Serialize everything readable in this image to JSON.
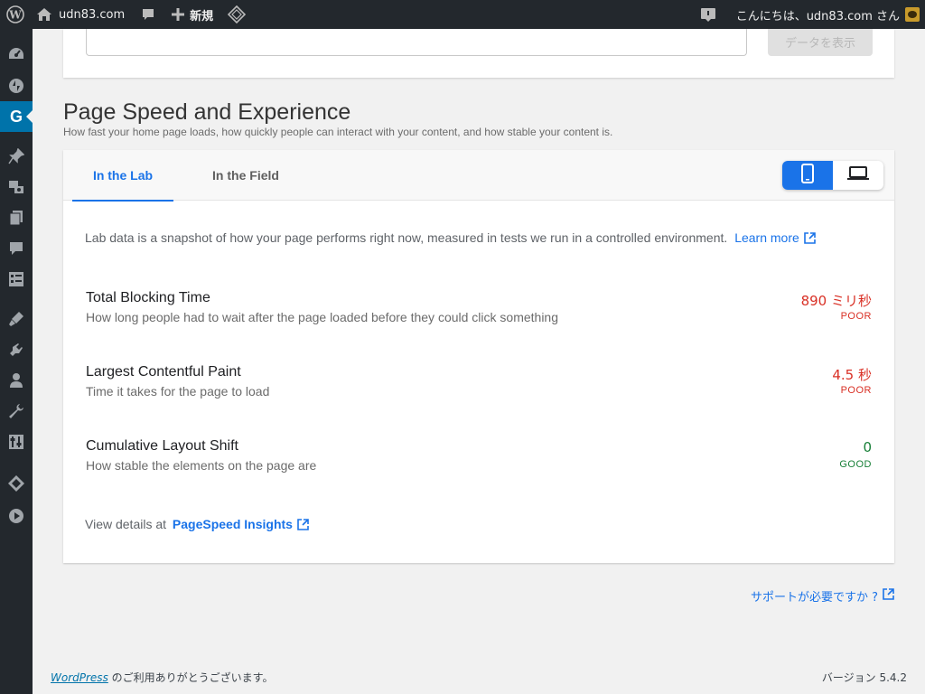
{
  "adminbar": {
    "site_name": "udn83.com",
    "new_label": "新規",
    "greeting": "こんにちは、udn83.com さん",
    "icons": [
      "wordpress-logo-icon",
      "home-icon",
      "comment-icon",
      "plus-icon",
      "diamond-icon",
      "notification-icon",
      "avatar"
    ]
  },
  "sidebar": {
    "icons": [
      "dashboard-icon",
      "jetpack-icon",
      "site-kit-g-icon",
      "pin-icon",
      "media-icon",
      "pages-icon",
      "comments-icon",
      "forms-icon",
      "appearance-icon",
      "plugins-icon",
      "users-icon",
      "tools-icon",
      "settings-icon",
      "diamond-icon",
      "play-icon"
    ],
    "active_index": 2
  },
  "top_card": {
    "button_label": "データを表示"
  },
  "section": {
    "title": "Page Speed and Experience",
    "subtitle": "How fast your home page loads, how quickly people can interact with your content, and how stable your content is."
  },
  "tabs": [
    {
      "label": "In the Lab",
      "active": true
    },
    {
      "label": "In the Field",
      "active": false
    }
  ],
  "device_toggle": {
    "selected": "mobile",
    "options": [
      "mobile-icon",
      "desktop-icon"
    ]
  },
  "lab": {
    "description": "Lab data is a snapshot of how your page performs right now, measured in tests we run in a controlled environment.",
    "learn_more": "Learn more"
  },
  "metrics": [
    {
      "name": "Total Blocking Time",
      "description": "How long people had to wait after the page loaded before they could click something",
      "value": "890 ミリ秒",
      "category": "POOR",
      "status": "poor"
    },
    {
      "name": "Largest Contentful Paint",
      "description": "Time it takes for the page to load",
      "value": "4.5 秒",
      "category": "POOR",
      "status": "poor"
    },
    {
      "name": "Cumulative Layout Shift",
      "description": "How stable the elements on the page are",
      "value": "0",
      "category": "GOOD",
      "status": "good"
    }
  ],
  "view_details": {
    "prefix": "View details at",
    "link": "PageSpeed Insights"
  },
  "support_link": "サポートが必要ですか ?",
  "footer": {
    "wordpress": "WordPress",
    "thanks": " のご利用ありがとうございます。",
    "version": "バージョン 5.4.2"
  },
  "colors": {
    "accent": "#1a73e8",
    "poor": "#d93025",
    "good": "#188038",
    "admin_bg": "#23282d",
    "wp_blue": "#0073aa"
  }
}
